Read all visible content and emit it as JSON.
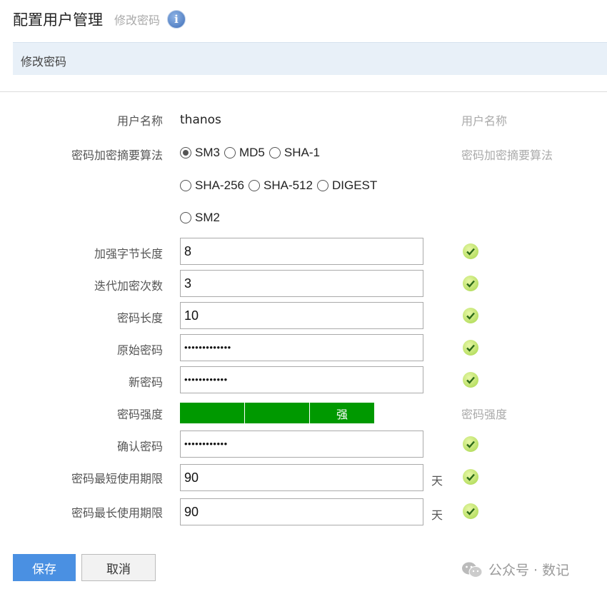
{
  "header": {
    "title": "配置用户管理",
    "subtitle": "修改密码"
  },
  "section": {
    "title": "修改密码"
  },
  "form": {
    "username": {
      "label": "用户名称",
      "value": "thanos",
      "hint": "用户名称"
    },
    "algorithm": {
      "label": "密码加密摘要算法",
      "hint": "密码加密摘要算法",
      "options": [
        "SM3",
        "MD5",
        "SHA-1",
        "SHA-256",
        "SHA-512",
        "DIGEST",
        "SM2"
      ],
      "selected": "SM3"
    },
    "salt_length": {
      "label": "加强字节长度",
      "value": "8"
    },
    "iterations": {
      "label": "迭代加密次数",
      "value": "3"
    },
    "password_length": {
      "label": "密码长度",
      "value": "10"
    },
    "old_password": {
      "label": "原始密码",
      "value": "•••••••••••••"
    },
    "new_password": {
      "label": "新密码",
      "value": "••••••••••••"
    },
    "strength": {
      "label": "密码强度",
      "text": "强",
      "hint": "密码强度",
      "color": "#009900"
    },
    "confirm_password": {
      "label": "确认密码",
      "value": "••••••••••••"
    },
    "min_age": {
      "label": "密码最短使用期限",
      "value": "90",
      "unit": "天"
    },
    "max_age": {
      "label": "密码最长使用期限",
      "value": "90",
      "unit": "天"
    }
  },
  "buttons": {
    "save": "保存",
    "cancel": "取消"
  },
  "watermark": {
    "text": "公众号 · 数记"
  },
  "colors": {
    "primary": "#4a90e2",
    "section_bg": "#e8f0f8",
    "valid": "#a6d64a"
  }
}
